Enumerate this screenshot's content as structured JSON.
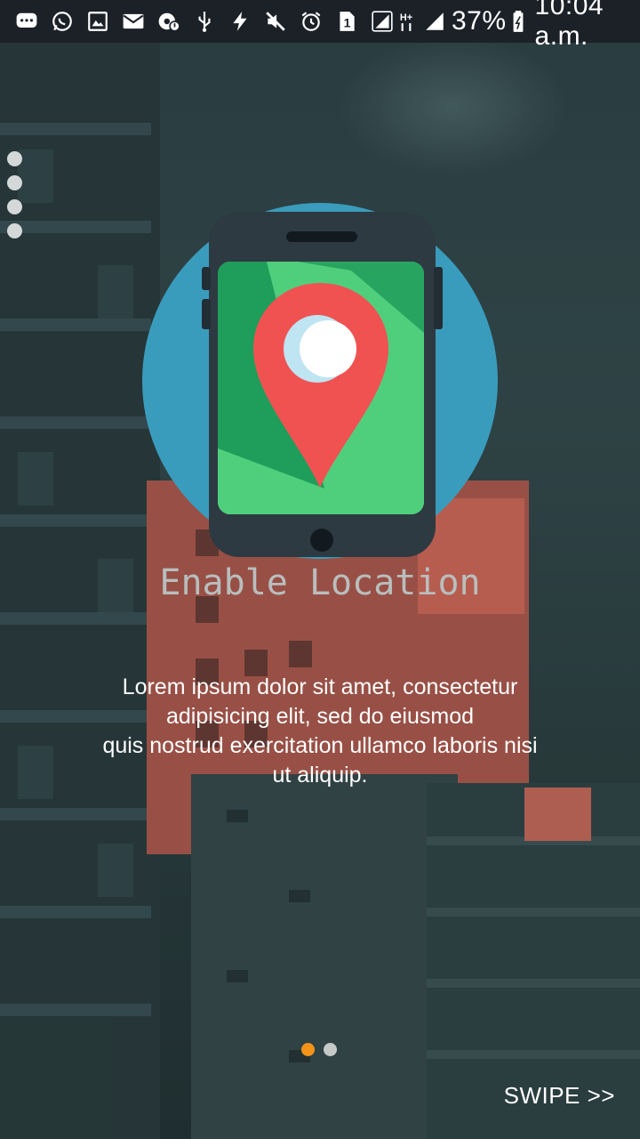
{
  "status_bar": {
    "battery_percent": "37%",
    "time": "10:04 a.m.",
    "sim_slot": "1",
    "network_type": "H+",
    "icons": [
      "message-icon",
      "whatsapp-icon",
      "gallery-icon",
      "email-icon",
      "settings-alert-icon",
      "usb-icon",
      "flash-icon",
      "mute-icon",
      "alarm-icon",
      "sim-icon",
      "signal-icon",
      "network-type-icon",
      "signal-icon-2",
      "battery-icon"
    ]
  },
  "onboarding": {
    "title": "Enable Location",
    "description_lines": [
      "Lorem ipsum dolor sit amet, consectetur",
      "adipisicing elit, sed do eiusmod",
      "quis nostrud exercitation ullamco laboris nisi",
      "ut aliquip."
    ],
    "swipe_label": "SWIPE >>",
    "page_indicator": {
      "count": 2,
      "active_index": 0,
      "active_color": "#f39419",
      "inactive_color": "#c7c9c9"
    }
  },
  "colors": {
    "status_bar_bg": "#1c2128",
    "circle": "#3a9cbc",
    "phone_body": "#2d3a42",
    "screen_green": "#4fcf7c",
    "screen_dark_green": "#1e9e5a",
    "pin_red": "#f05252",
    "title_gray": "#b9bebe"
  }
}
